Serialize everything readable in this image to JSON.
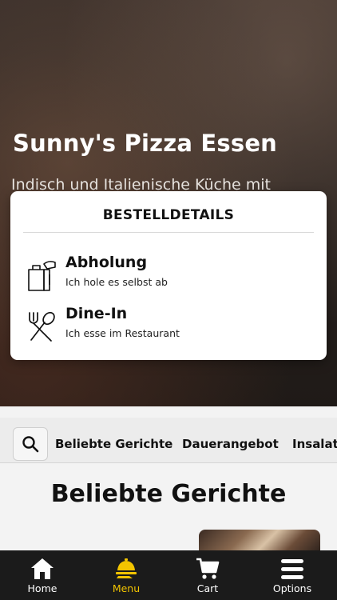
{
  "hero": {
    "title": "Sunny's Pizza Essen",
    "subtitle": "Indisch und Italienische Küche mit"
  },
  "modal": {
    "title": "BESTELLDETAILS",
    "options": [
      {
        "title": "Abholung",
        "subtitle": "Ich hole es selbst ab",
        "icon": "takeaway-bag-icon"
      },
      {
        "title": "Dine-In",
        "subtitle": "Ich esse im Restaurant",
        "icon": "cutlery-icon"
      }
    ]
  },
  "categories": {
    "search_icon": "search-icon",
    "items": [
      "Beliebte Gerichte",
      "Dauerangebot",
      "Insalat"
    ]
  },
  "section": {
    "title": "Beliebte Gerichte"
  },
  "bottom_nav": {
    "active": "Menu",
    "accent_color": "#f2c400",
    "items": [
      {
        "label": "Home",
        "icon": "home-icon"
      },
      {
        "label": "Menu",
        "icon": "menu-icon"
      },
      {
        "label": "Cart",
        "icon": "cart-icon"
      },
      {
        "label": "Options",
        "icon": "hamburger-icon"
      }
    ]
  }
}
